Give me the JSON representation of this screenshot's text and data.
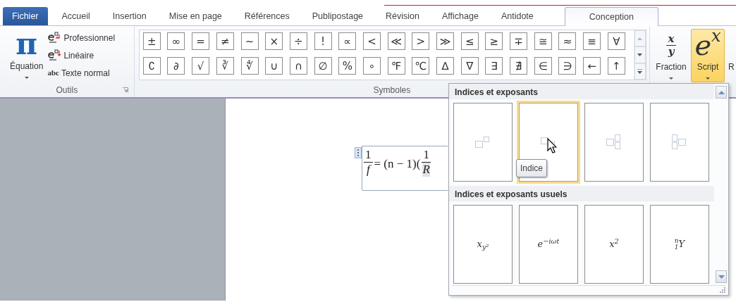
{
  "tabs": [
    {
      "label": "Fichier",
      "kind": "file",
      "selected": false
    },
    {
      "label": "Accueil",
      "kind": "normal",
      "selected": false
    },
    {
      "label": "Insertion",
      "kind": "normal",
      "selected": false
    },
    {
      "label": "Mise en page",
      "kind": "normal",
      "selected": false
    },
    {
      "label": "Références",
      "kind": "normal",
      "selected": false
    },
    {
      "label": "Publipostage",
      "kind": "normal",
      "selected": false
    },
    {
      "label": "Révision",
      "kind": "normal",
      "selected": false
    },
    {
      "label": "Affichage",
      "kind": "normal",
      "selected": false
    },
    {
      "label": "Antidote",
      "kind": "normal",
      "selected": false
    },
    {
      "label": "Conception",
      "kind": "contextual",
      "selected": true
    }
  ],
  "outils": {
    "label": "Outils",
    "big_button": {
      "glyph": "π",
      "label": "Équation"
    },
    "items": [
      {
        "label": "Professionnel",
        "kind": "professional"
      },
      {
        "label": "Linéaire",
        "kind": "linear"
      },
      {
        "label": "Texte normal",
        "kind": "plain",
        "glyph": "abc"
      }
    ]
  },
  "symboles": {
    "label": "Symboles",
    "rows": [
      [
        "±",
        "∞",
        "=",
        "≠",
        "~",
        "×",
        "÷",
        "!",
        "∝",
        "<",
        "≪",
        ">",
        "≫",
        "≤",
        "≥",
        "∓",
        "≅",
        "≈",
        "≡",
        "∀"
      ],
      [
        "∁",
        "∂",
        "√",
        "∛",
        "∜",
        "∪",
        "∩",
        "∅",
        "%",
        "∘",
        "℉",
        "℃",
        "∆",
        "∇",
        "∃",
        "∄",
        "∈",
        "∋",
        "←",
        "↑"
      ]
    ]
  },
  "structures": [
    {
      "kind": "fraction",
      "label": "Fraction",
      "top": "x",
      "bottom": "y",
      "selected": false
    },
    {
      "kind": "script",
      "label": "Script",
      "base": "e",
      "sup": "x",
      "selected": true
    },
    {
      "kind": "cut",
      "label": "R",
      "selected": false
    }
  ],
  "equation": {
    "lhs_num": "1",
    "lhs_den": "f",
    "middle": "= (n − 1)(",
    "rhs_num": "1",
    "rhs_den": "R",
    "rhs_den_selected": true
  },
  "gallery": {
    "sections": [
      {
        "title": "Indices et exposants",
        "items": [
          {
            "kind": "sup",
            "selected": false
          },
          {
            "kind": "sub",
            "selected": true
          },
          {
            "kind": "subsup",
            "selected": false
          },
          {
            "kind": "presubsup",
            "selected": false
          }
        ]
      },
      {
        "title": "Indices et exposants usuels",
        "items": [
          {
            "kind": "formula",
            "text": "x$_{y²}$",
            "selected": false
          },
          {
            "kind": "formula",
            "text": "e$^{−iωt}$",
            "selected": false
          },
          {
            "kind": "formula",
            "text": "x$^{2}$",
            "selected": false
          },
          {
            "kind": "prescript",
            "sup": "n",
            "sub": "1",
            "base": "Y",
            "selected": false
          }
        ]
      }
    ]
  },
  "tooltip": {
    "text": "Indice"
  }
}
